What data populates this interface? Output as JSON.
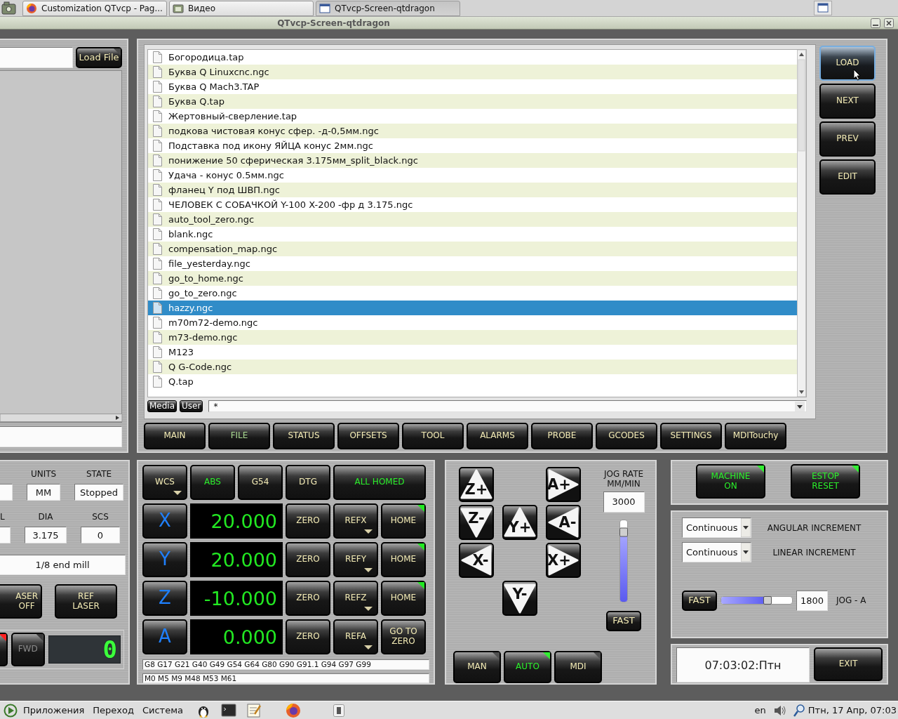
{
  "taskbar_top": {
    "tabs": [
      {
        "label": "Customization QTvcp - Pag...",
        "kind": "browser",
        "selected": false
      },
      {
        "label": "Видео",
        "kind": "folder",
        "selected": false
      },
      {
        "label": "QTvcp-Screen-qtdragon",
        "kind": "window",
        "selected": true
      }
    ]
  },
  "window": {
    "title": "QTvcp-Screen-qtdragon"
  },
  "file_loader": {
    "load_button": {
      "label": "Load File",
      "color": "#4a4a4a"
    }
  },
  "file_panel": {
    "files": [
      {
        "name": "Богородица.tap",
        "selected": false
      },
      {
        "name": "Буква Q Linuxcnc.ngc",
        "selected": false
      },
      {
        "name": "Буква Q Mach3.TAP",
        "selected": false
      },
      {
        "name": "Буква Q.tap",
        "selected": false
      },
      {
        "name": "Жертовный-сверление.tap",
        "selected": false
      },
      {
        "name": "подкова чистовая конус сфер. -д-0,5мм.ngc",
        "selected": false
      },
      {
        "name": "Подставка под икону ЯЙЦА конус 2мм.ngc",
        "selected": false
      },
      {
        "name": "понижение 50 сферическая 3.175мм_split_black.ngc",
        "selected": false
      },
      {
        "name": "Удача - конус 0.5мм.ngc",
        "selected": false
      },
      {
        "name": "фланец Y под ШВП.ngc",
        "selected": false
      },
      {
        "name": "ЧЕЛОВЕК С СОБАЧКОЙ Y-100 X-200 -фр д 3.175.ngc",
        "selected": false
      },
      {
        "name": "auto_tool_zero.ngc",
        "selected": false
      },
      {
        "name": "blank.ngc",
        "selected": false
      },
      {
        "name": "compensation_map.ngc",
        "selected": false
      },
      {
        "name": "file_yesterday.ngc",
        "selected": false
      },
      {
        "name": "go_to_home.ngc",
        "selected": false
      },
      {
        "name": "go_to_zero.ngc",
        "selected": false
      },
      {
        "name": "hazzy.ngc",
        "selected": true
      },
      {
        "name": "m70m72-demo.ngc",
        "selected": false
      },
      {
        "name": "m73-demo.ngc",
        "selected": false
      },
      {
        "name": "M123",
        "selected": false
      },
      {
        "name": "Q G-Code.ngc",
        "selected": false
      },
      {
        "name": "Q.tap",
        "selected": false
      }
    ],
    "filter_buttons": [
      "Media",
      "User"
    ],
    "filter": "*",
    "side_buttons": [
      {
        "label": "LOAD",
        "focused": true
      },
      {
        "label": "NEXT",
        "focused": false
      },
      {
        "label": "PREV",
        "focused": false
      },
      {
        "label": "EDIT",
        "focused": false
      }
    ]
  },
  "tabs": [
    {
      "label": "MAIN",
      "selected": false
    },
    {
      "label": "FILE",
      "selected": true
    },
    {
      "label": "STATUS",
      "selected": false
    },
    {
      "label": "OFFSETS",
      "selected": false
    },
    {
      "label": "TOOL",
      "selected": false
    },
    {
      "label": "ALARMS",
      "selected": false
    },
    {
      "label": "PROBE",
      "selected": false
    },
    {
      "label": "GCODES",
      "selected": false
    },
    {
      "label": "SETTINGS",
      "selected": false
    },
    {
      "label": "MDITouchy",
      "selected": false
    }
  ],
  "tool_panel": {
    "row_1": [
      {
        "label": "UNITS",
        "value": "MM"
      },
      {
        "label": "STATE",
        "value": "Stopped"
      }
    ],
    "row_2": [
      {
        "label": "L"
      },
      {
        "label": "DIA",
        "value": "3.175"
      },
      {
        "label": "SCS",
        "value": "0"
      }
    ],
    "description": "1/8 end mill",
    "buttons": [
      "ASER\nOFF",
      "REF\nLASER"
    ],
    "spindle_buttons": [
      {
        "color": "#ff2020"
      },
      {
        "label": "FWD",
        "color": "#3c3c3c"
      }
    ],
    "spindle_display": "0"
  },
  "dro": {
    "header": [
      {
        "label": "WCS",
        "active": false,
        "caret": true
      },
      {
        "label": "ABS",
        "active": true,
        "caret": false
      },
      {
        "label": "G54",
        "active": false,
        "caret": false
      },
      {
        "label": "DTG",
        "active": false,
        "caret": false
      },
      {
        "label": "ALL HOMED",
        "active": true,
        "caret": false
      }
    ],
    "axes": [
      {
        "axis": "X",
        "value": "20.000",
        "zero": "ZERO",
        "ref": "REFX",
        "home": "HOME",
        "homed": true
      },
      {
        "axis": "Y",
        "value": "20.000",
        "zero": "ZERO",
        "ref": "REFY",
        "home": "HOME",
        "homed": true
      },
      {
        "axis": "Z",
        "value": "-10.000",
        "zero": "ZERO",
        "ref": "REFZ",
        "home": "HOME",
        "homed": true
      },
      {
        "axis": "A",
        "value": "0.000",
        "zero": "ZERO",
        "ref": "REFA",
        "home": "GO TO\nZERO",
        "homed": false
      }
    ],
    "gcodes": [
      "G8 G17 G21 G40 G49 G54 G64 G80 G90 G91.1 G94 G97 G99",
      "M0 M5 M9 M48 M53 M61"
    ]
  },
  "jog": {
    "buttons": [
      {
        "label": "Z+",
        "kind": "up"
      },
      {
        "label": "A+",
        "kind": "right"
      },
      {
        "label": "Z-",
        "kind": "down"
      },
      {
        "label": "Y+",
        "kind": "up"
      },
      {
        "label": "A-",
        "kind": "left"
      },
      {
        "label": "X-",
        "kind": "left"
      },
      {
        "label": "X+",
        "kind": "right"
      },
      {
        "label": "Y-",
        "kind": "down"
      }
    ],
    "rate_label": "JOG RATE\nMM/MIN",
    "rate": "3000",
    "level": 0.85,
    "fast": "FAST",
    "modes": [
      {
        "label": "MAN",
        "selected": false
      },
      {
        "label": "AUTO",
        "selected": true
      },
      {
        "label": "MDI",
        "selected": false
      }
    ]
  },
  "machine": [
    {
      "label": "MACHINE\nON",
      "on": true
    },
    {
      "label": "ESTOP\nRESET",
      "on": true
    }
  ],
  "increments": [
    {
      "value": "Continuous",
      "label": "ANGULAR INCREMENT"
    },
    {
      "value": "Continuous",
      "label": "LINEAR INCREMENT"
    }
  ],
  "angular_jog": {
    "fast": "FAST",
    "level": 0.65,
    "value": "1800",
    "label": "JOG - A"
  },
  "clock": "07:03:02:Птн",
  "exit": "EXIT",
  "taskbar_bottom": {
    "menus": [
      "Приложения",
      "Переход",
      "Система"
    ],
    "language": "en",
    "datetime": "Птн, 17 Апр, 07:03"
  }
}
